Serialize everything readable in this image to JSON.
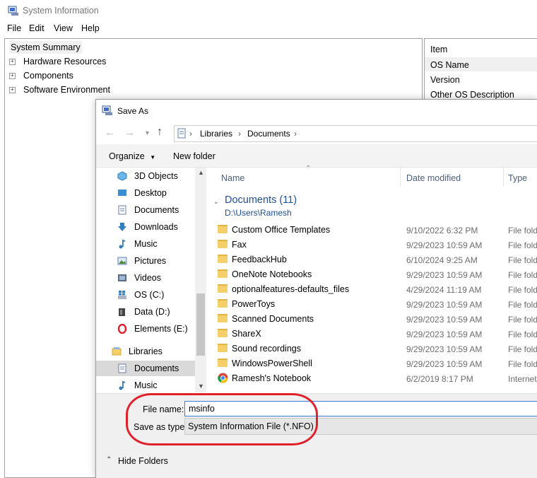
{
  "window": {
    "title": "System Information",
    "menu": [
      "File",
      "Edit",
      "View",
      "Help"
    ]
  },
  "tree": {
    "items": [
      "System Summary",
      "Hardware Resources",
      "Components",
      "Software Environment"
    ]
  },
  "details": {
    "header": "Item",
    "rows": [
      "OS Name",
      "Version",
      "Other OS Description"
    ]
  },
  "dialog": {
    "title": "Save As",
    "breadcrumb": [
      "Libraries",
      "Documents"
    ],
    "toolbar": {
      "organize": "Organize",
      "new_folder": "New folder"
    },
    "nav_items": [
      {
        "label": "3D Objects",
        "icon": "3d-objects-icon"
      },
      {
        "label": "Desktop",
        "icon": "desktop-icon"
      },
      {
        "label": "Documents",
        "icon": "documents-icon"
      },
      {
        "label": "Downloads",
        "icon": "downloads-icon"
      },
      {
        "label": "Music",
        "icon": "music-icon"
      },
      {
        "label": "Pictures",
        "icon": "pictures-icon"
      },
      {
        "label": "Videos",
        "icon": "videos-icon"
      },
      {
        "label": "OS (C:)",
        "icon": "drive-icon"
      },
      {
        "label": "Data (D:)",
        "icon": "drive-icon"
      },
      {
        "label": "Elements (E:)",
        "icon": "opera-drive-icon"
      },
      {
        "label": "Libraries",
        "icon": "libraries-icon"
      },
      {
        "label": "Documents",
        "icon": "documents-icon"
      },
      {
        "label": "Music",
        "icon": "music-icon"
      }
    ],
    "columns": {
      "name": "Name",
      "date": "Date modified",
      "type": "Type"
    },
    "group": {
      "title": "Documents (11)",
      "path": "D:\\Users\\Ramesh"
    },
    "files": [
      {
        "name": "Custom Office Templates",
        "date": "9/10/2022 6:32 PM",
        "type": "File fold"
      },
      {
        "name": "Fax",
        "date": "9/29/2023 10:59 AM",
        "type": "File fold"
      },
      {
        "name": "FeedbackHub",
        "date": "6/10/2024 9:25 AM",
        "type": "File fold"
      },
      {
        "name": "OneNote Notebooks",
        "date": "9/29/2023 10:59 AM",
        "type": "File fold"
      },
      {
        "name": "optionalfeatures-defaults_files",
        "date": "4/29/2024 11:19 AM",
        "type": "File fold"
      },
      {
        "name": "PowerToys",
        "date": "9/29/2023 10:59 AM",
        "type": "File fold"
      },
      {
        "name": "Scanned Documents",
        "date": "9/29/2023 10:59 AM",
        "type": "File fold"
      },
      {
        "name": "ShareX",
        "date": "9/29/2023 10:59 AM",
        "type": "File fold"
      },
      {
        "name": "Sound recordings",
        "date": "9/29/2023 10:59 AM",
        "type": "File fold"
      },
      {
        "name": "WindowsPowerShell",
        "date": "9/29/2023 10:59 AM",
        "type": "File fold"
      },
      {
        "name": "Ramesh's Notebook",
        "date": "6/2/2019 8:17 PM",
        "type": "Internet"
      }
    ],
    "file_name_label": "File name:",
    "file_name_value": "msinfo",
    "save_type_label": "Save as type:",
    "save_type_value": "System Information File (*.NFO)",
    "hide_folders": "Hide Folders"
  },
  "colors": {
    "annotation": "#e0202a",
    "accent": "#3a7bd5",
    "link": "#1e4e9c"
  }
}
